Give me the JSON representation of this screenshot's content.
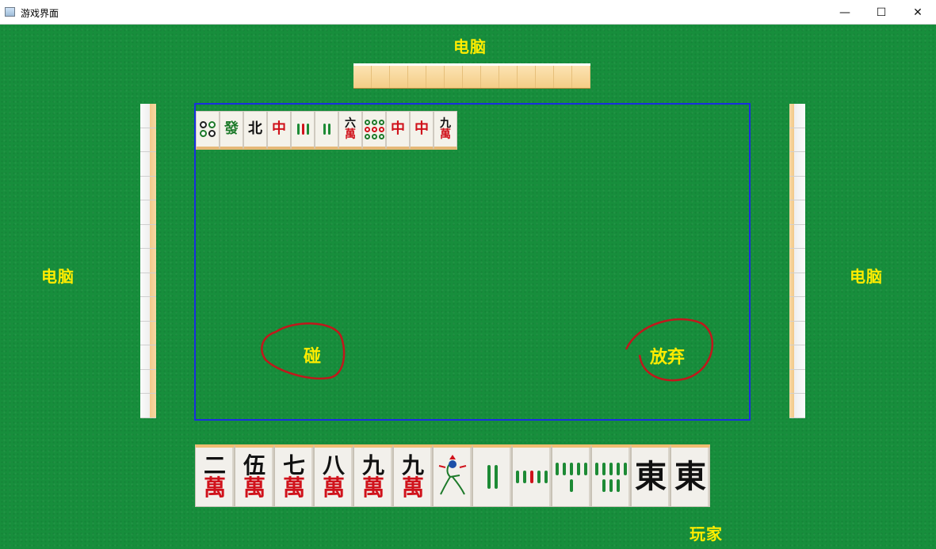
{
  "window": {
    "title": "游戏界面",
    "minimize": "—",
    "maximize": "☐",
    "close": "✕"
  },
  "players": {
    "top": "电脑",
    "left": "电脑",
    "right": "电脑",
    "bottom": "玩家"
  },
  "actions": {
    "pong": "碰",
    "pass": "放弃"
  },
  "discards": [
    {
      "kind": "circles",
      "count": 4
    },
    {
      "kind": "text",
      "text": "發",
      "color": "green"
    },
    {
      "kind": "text",
      "text": "北",
      "color": "black"
    },
    {
      "kind": "text",
      "text": "中",
      "color": "red"
    },
    {
      "kind": "bamboo",
      "count": 3
    },
    {
      "kind": "bamboo",
      "count": 2
    },
    {
      "kind": "wan",
      "num": "六",
      "suit": "萬"
    },
    {
      "kind": "circles",
      "count": 9
    },
    {
      "kind": "text",
      "text": "中",
      "color": "red"
    },
    {
      "kind": "text",
      "text": "中",
      "color": "red"
    },
    {
      "kind": "wan",
      "num": "九",
      "suit": "萬"
    }
  ],
  "hand": [
    {
      "kind": "wan",
      "num": "二",
      "suit": "萬"
    },
    {
      "kind": "wan",
      "num": "伍",
      "suit": "萬"
    },
    {
      "kind": "wan",
      "num": "七",
      "suit": "萬"
    },
    {
      "kind": "wan",
      "num": "八",
      "suit": "萬"
    },
    {
      "kind": "wan",
      "num": "九",
      "suit": "萬"
    },
    {
      "kind": "wan",
      "num": "九",
      "suit": "萬"
    },
    {
      "kind": "bird",
      "text": "bird-icon"
    },
    {
      "kind": "bamboo",
      "count": 2
    },
    {
      "kind": "bamboo",
      "count": 5
    },
    {
      "kind": "bamboo",
      "count": 6
    },
    {
      "kind": "bamboo",
      "count": 8
    },
    {
      "kind": "text",
      "text": "東",
      "color": "black"
    },
    {
      "kind": "text",
      "text": "東",
      "color": "black"
    }
  ],
  "top_back_tiles": 13,
  "side_back_tiles": 13
}
